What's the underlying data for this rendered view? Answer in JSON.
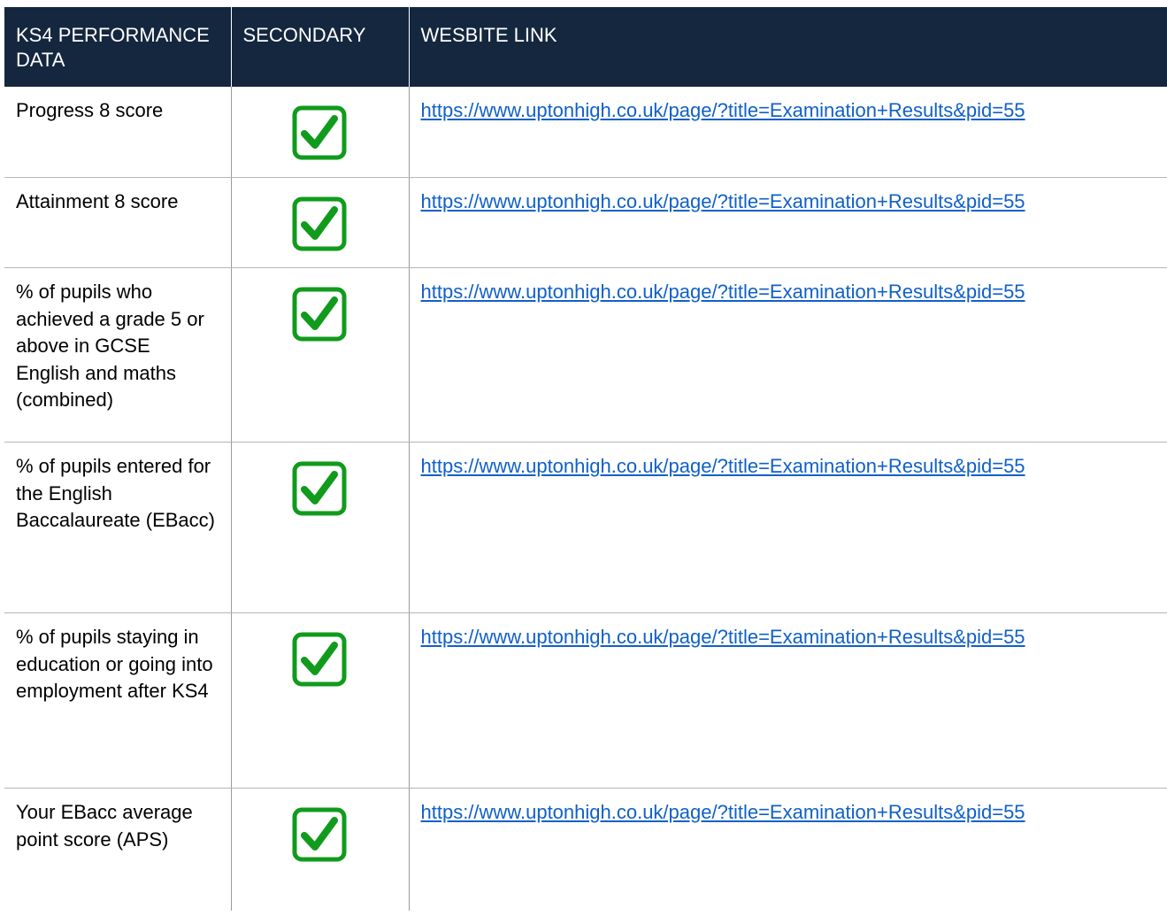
{
  "table": {
    "headers": [
      "KS4 PERFORMANCE DATA",
      "SECONDARY",
      "WESBITE LINK"
    ],
    "rows": [
      {
        "measure": "Progress 8 score",
        "secondary_icon": "checkbox-checked-icon",
        "link": "https://www.uptonhigh.co.uk/page/?title=Examination+Results&pid=55"
      },
      {
        "measure": "Attainment 8 score",
        "secondary_icon": "checkbox-checked-icon",
        "link": "https://www.uptonhigh.co.uk/page/?title=Examination+Results&pid=55"
      },
      {
        "measure": "% of pupils who achieved a grade 5 or above in GCSE English and maths (combined)",
        "secondary_icon": "checkbox-checked-icon",
        "link": "https://www.uptonhigh.co.uk/page/?title=Examination+Results&pid=55"
      },
      {
        "measure": "% of pupils entered for the English Baccalaureate (EBacc)",
        "secondary_icon": "checkbox-checked-icon",
        "link": "https://www.uptonhigh.co.uk/page/?title=Examination+Results&pid=55"
      },
      {
        "measure": "% of pupils staying in education or going into employment after KS4",
        "secondary_icon": "checkbox-checked-icon",
        "link": "https://www.uptonhigh.co.uk/page/?title=Examination+Results&pid=55"
      },
      {
        "measure": "Your EBacc average point score (APS)",
        "secondary_icon": "checkbox-checked-icon",
        "link": "https://www.uptonhigh.co.uk/page/?title=Examination+Results&pid=55"
      }
    ]
  },
  "colors": {
    "header_bg": "#14273f",
    "header_text": "#ffffff",
    "check_green": "#119b1c",
    "link_blue": "#1060c8"
  }
}
